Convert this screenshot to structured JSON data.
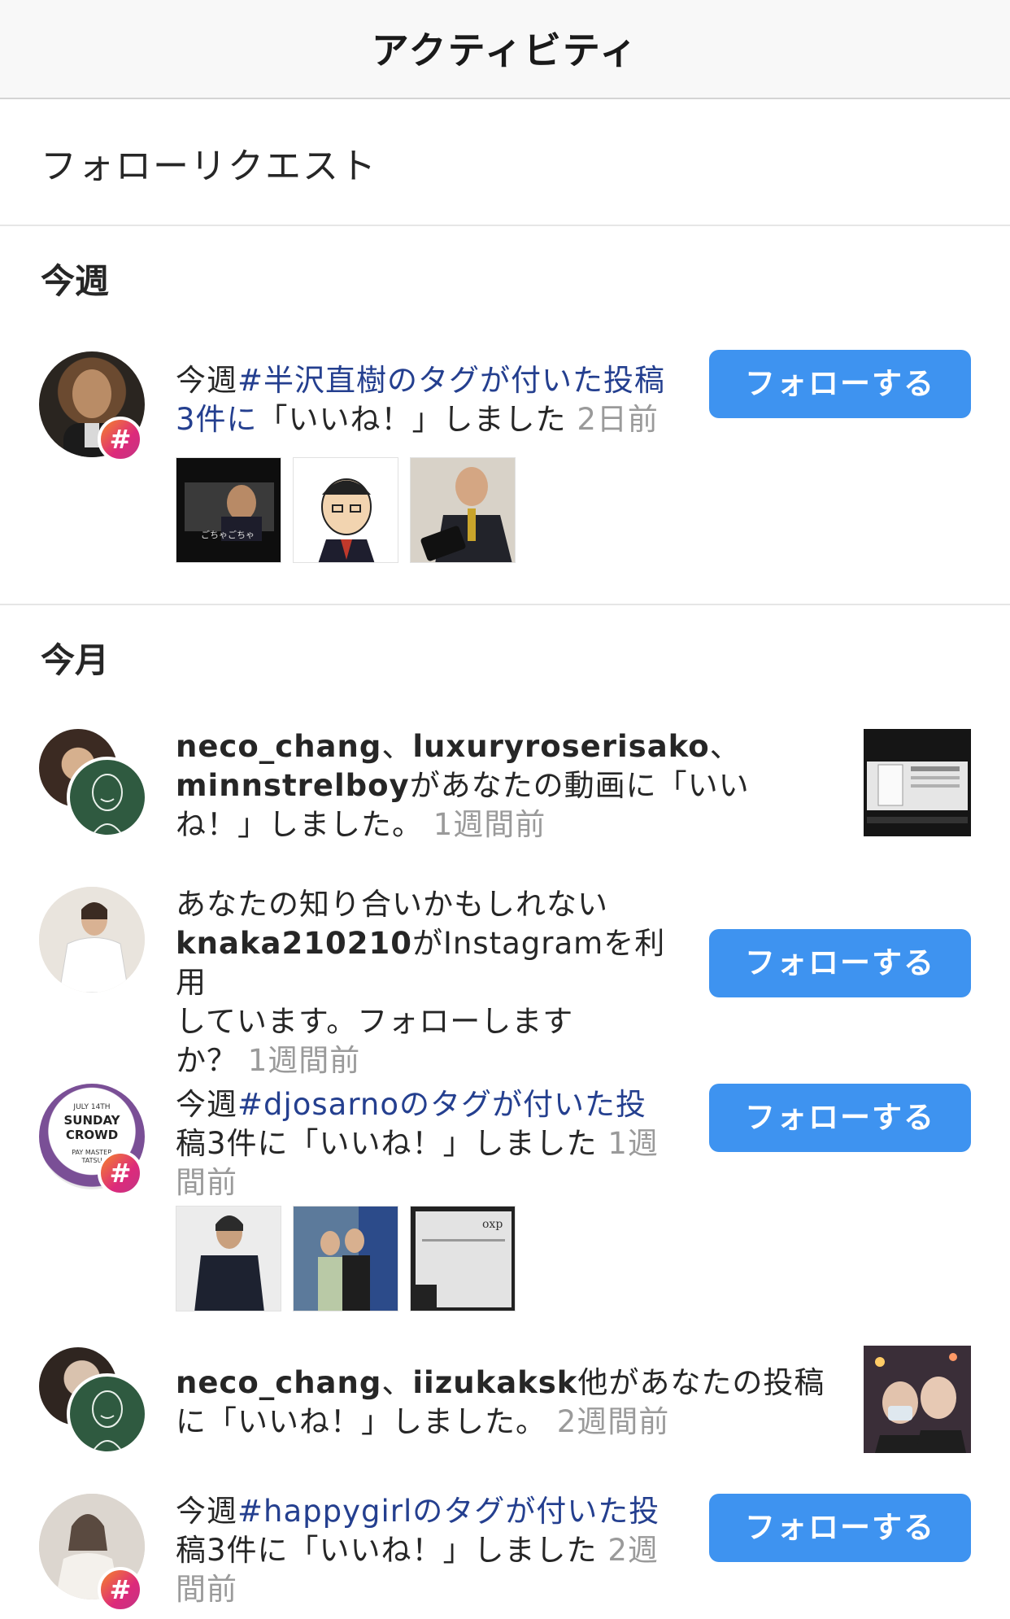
{
  "header": {
    "title": "アクティビティ"
  },
  "follow_requests": {
    "label": "フォローリクエスト"
  },
  "sections": {
    "this_week": "今週",
    "this_month": "今月"
  },
  "follow_label": "フォローする",
  "items": [
    {
      "prefix": "今週",
      "hashtag": "#半沢直樹",
      "line1_rest": "のタグが付いた投稿",
      "line2_count": "3件に",
      "line2_rest": "「いいね！」しました",
      "time": "2日前",
      "avatar_icon": "hashtag-icon",
      "badge": "#"
    },
    {
      "user1": "neco_chang",
      "sep1": "、",
      "user2": "luxuryroserisako",
      "sep2": "、",
      "user3": "minnstrelboy",
      "rest": "があなたの動画に「いい",
      "line3": "ね！」しました。",
      "time": "1週間前"
    },
    {
      "line1": "あなたの知り合いかもしれない",
      "user": "knaka210210",
      "line2_rest": "がInstagramを利用",
      "line3": "しています。フォローします",
      "line4": "か？",
      "time": "1週間前"
    },
    {
      "prefix": "今週",
      "hashtag": "#djosarno",
      "line1_rest": "のタグが付いた投",
      "line2": "稿3件に「いいね！」しました",
      "time_a": "1週",
      "time_b": "間前",
      "avatar_text": [
        "JULY 14TH",
        "SUNDAY",
        "CROWD",
        "PAY MASTER",
        "TATSU"
      ],
      "badge": "#"
    },
    {
      "user1": "neco_chang",
      "sep": "、",
      "user2": "iizukaksk",
      "rest": "他があなたの投稿",
      "line2": "に「いいね！」しました。",
      "time": "2週間前"
    },
    {
      "prefix": "今週",
      "hashtag": "#happygirl",
      "line1_rest": "のタグが付いた投",
      "line2": "稿3件に「いいね！」しました",
      "time_a": "2週",
      "time_b": "間前",
      "badge": "#"
    }
  ],
  "thumb_captions": {
    "drama": "ごちゃごちゃ",
    "record": "oxp"
  },
  "colors": {
    "follow_button": "#3e93f0",
    "hashtag_text": "#243f8f",
    "time_text": "#9a9a9a",
    "badge_gradient": "#dd2a7b"
  }
}
